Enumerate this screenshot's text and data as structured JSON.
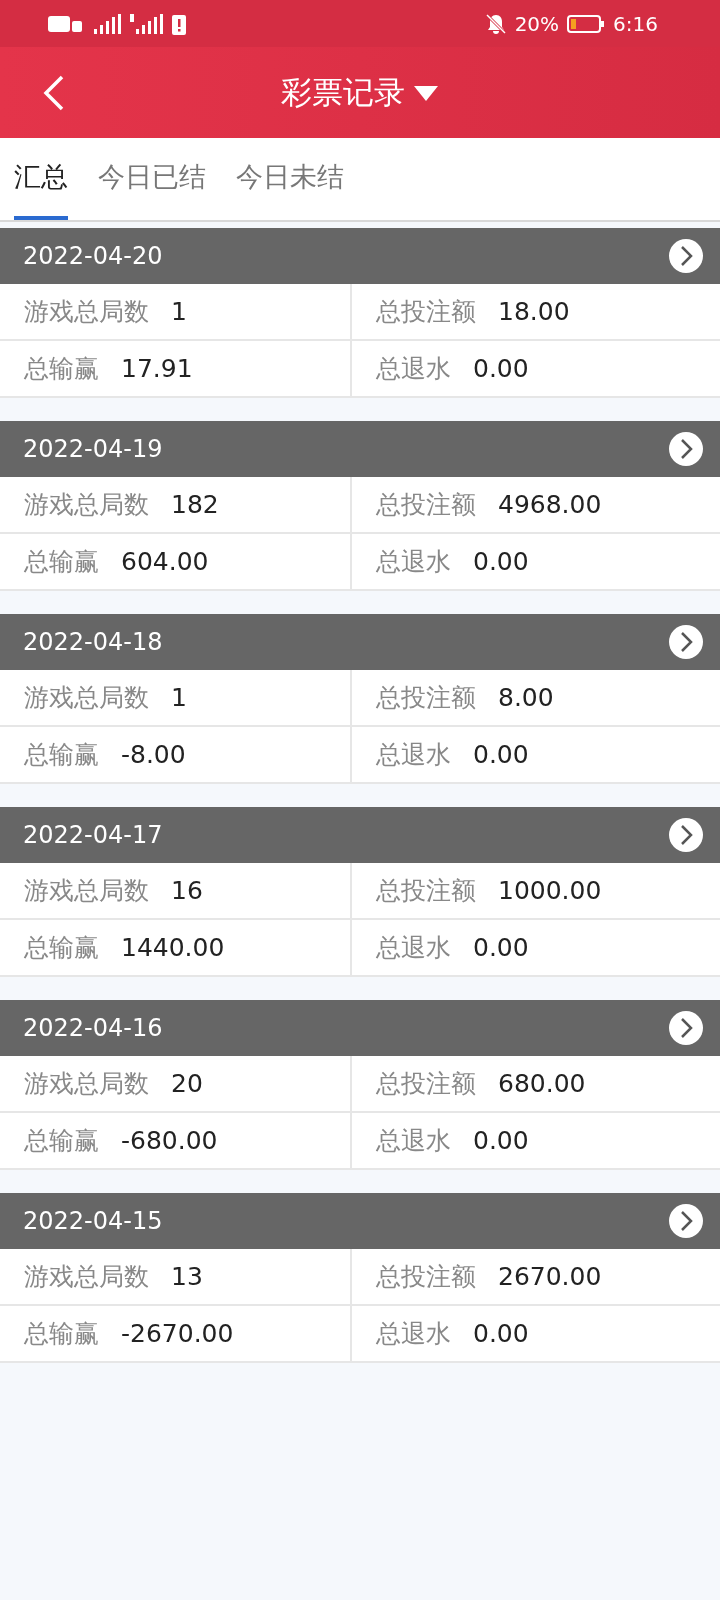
{
  "status_bar": {
    "battery": "20%",
    "time": "6:16"
  },
  "header": {
    "title": "彩票记录"
  },
  "tabs": [
    {
      "label": "汇总",
      "selected": true
    },
    {
      "label": "今日已结",
      "selected": false
    },
    {
      "label": "今日未结",
      "selected": false
    }
  ],
  "days": [
    {
      "date": "2022-04-20",
      "stats": [
        {
          "label": "游戏总局数",
          "value": "1"
        },
        {
          "label": "总投注额",
          "value": "18.00"
        },
        {
          "label": "总输赢",
          "value": "17.91"
        },
        {
          "label": "总退水",
          "value": "0.00"
        }
      ]
    },
    {
      "date": "2022-04-19",
      "stats": [
        {
          "label": "游戏总局数",
          "value": "182"
        },
        {
          "label": "总投注额",
          "value": "4968.00"
        },
        {
          "label": "总输赢",
          "value": "604.00"
        },
        {
          "label": "总退水",
          "value": "0.00"
        }
      ]
    },
    {
      "date": "2022-04-18",
      "stats": [
        {
          "label": "游戏总局数",
          "value": "1"
        },
        {
          "label": "总投注额",
          "value": "8.00"
        },
        {
          "label": "总输赢",
          "value": "-8.00"
        },
        {
          "label": "总退水",
          "value": "0.00"
        }
      ]
    },
    {
      "date": "2022-04-17",
      "stats": [
        {
          "label": "游戏总局数",
          "value": "16"
        },
        {
          "label": "总投注额",
          "value": "1000.00"
        },
        {
          "label": "总输赢",
          "value": "1440.00"
        },
        {
          "label": "总退水",
          "value": "0.00"
        }
      ]
    },
    {
      "date": "2022-04-16",
      "stats": [
        {
          "label": "游戏总局数",
          "value": "20"
        },
        {
          "label": "总投注额",
          "value": "680.00"
        },
        {
          "label": "总输赢",
          "value": "-680.00"
        },
        {
          "label": "总退水",
          "value": "0.00"
        }
      ]
    },
    {
      "date": "2022-04-15",
      "stats": [
        {
          "label": "游戏总局数",
          "value": "13"
        },
        {
          "label": "总投注额",
          "value": "2670.00"
        },
        {
          "label": "总输赢",
          "value": "-2670.00"
        },
        {
          "label": "总退水",
          "value": "0.00"
        }
      ]
    }
  ]
}
